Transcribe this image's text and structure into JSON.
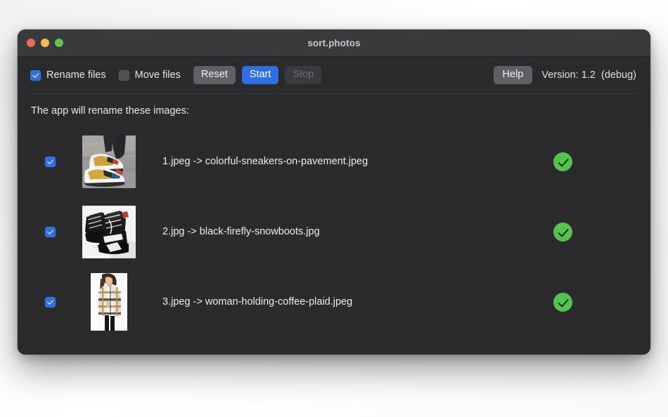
{
  "window": {
    "title": "sort.photos",
    "traffic_lights": [
      "close-button",
      "minimize-button",
      "zoom-button"
    ]
  },
  "toolbar": {
    "rename_files": {
      "label": "Rename files",
      "checked": true
    },
    "move_files": {
      "label": "Move files",
      "checked": false
    },
    "reset_label": "Reset",
    "start_label": "Start",
    "stop_label": "Stop",
    "help_label": "Help",
    "version_text": "Version: 1.2  (debug)"
  },
  "content": {
    "intro": "The app will rename these images:",
    "rows": [
      {
        "checked": true,
        "name": "1.jpeg -> colorful-sneakers-on-pavement.jpeg",
        "status": "success",
        "thumb": "colorful-sneakers-on-pavement"
      },
      {
        "checked": true,
        "name": "2.jpg -> black-firefly-snowboots.jpg",
        "status": "success",
        "thumb": "black-firefly-snowboots"
      },
      {
        "checked": true,
        "name": "3.jpeg -> woman-holding-coffee-plaid.jpeg",
        "status": "success",
        "thumb": "woman-holding-coffee-plaid"
      }
    ]
  },
  "colors": {
    "accent_blue": "#2f6fe4",
    "success_green": "#54c44e",
    "window_bg": "#2b2b2d",
    "titlebar_bg": "#3a3a3c",
    "close": "#ec6a5f",
    "minimize": "#f4bd50",
    "zoom": "#61c555"
  }
}
